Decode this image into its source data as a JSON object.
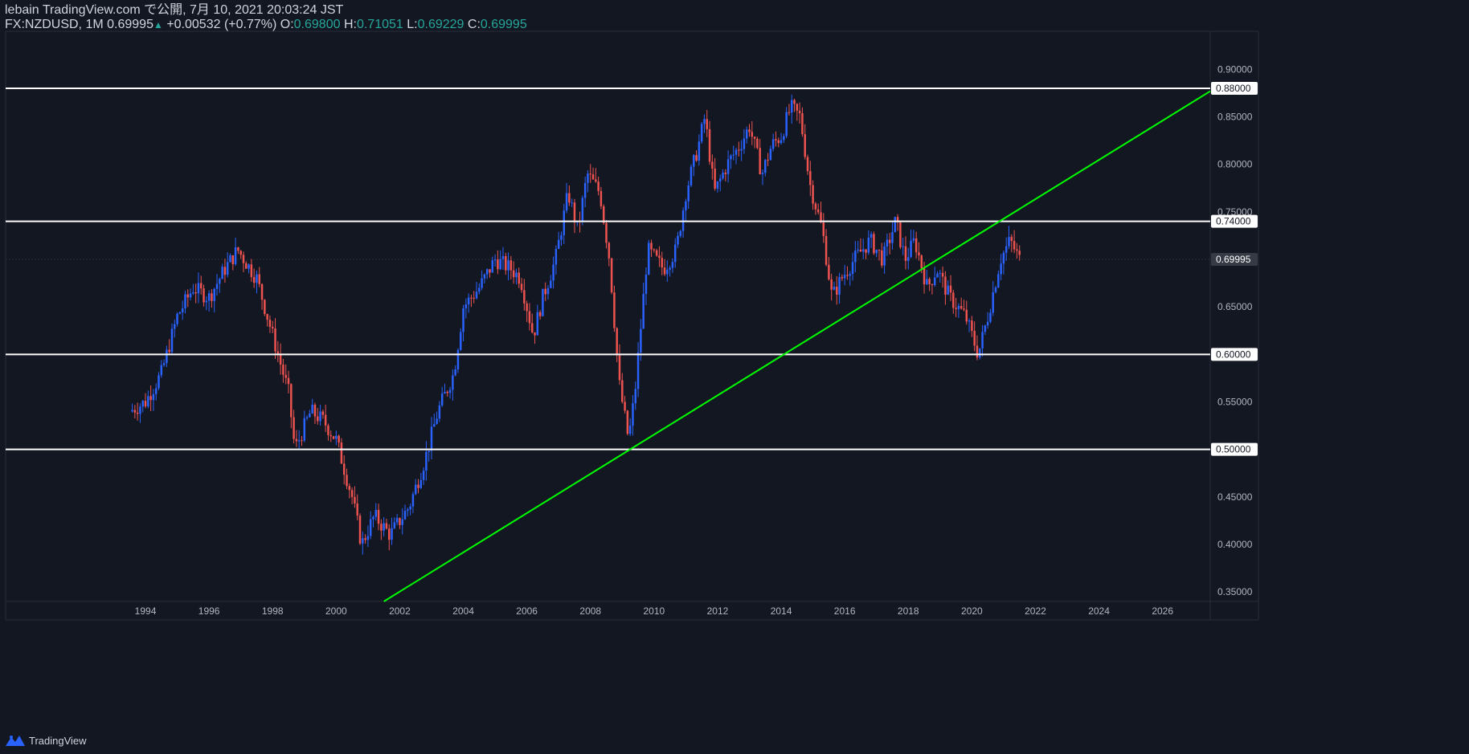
{
  "header": {
    "line1": "lebain TradingView.com で公開, 7月 10, 2021 20:03:24 JST",
    "symbol": "FX:NZDUSD, 1M",
    "last": "0.69995",
    "change_arrow": "▲",
    "change": "+0.00532 (+0.77%)",
    "o_label": "O:",
    "o_value": "0.69800",
    "h_label": "H:",
    "h_value": "0.71051",
    "l_label": "L:",
    "l_value": "0.69229",
    "c_label": "C:",
    "c_value": "0.69995"
  },
  "footer": {
    "brand": "TradingView"
  },
  "colors": {
    "background": "#131722",
    "up": "#2962ff",
    "down": "#ef5350",
    "level_line": "#ffffff",
    "trend_line": "#00ff00",
    "text": "#d1d4dc",
    "accent": "#26a69a"
  },
  "chart_data": {
    "type": "candlestick",
    "symbol": "NZDUSD",
    "interval": "1M",
    "xlim": [
      1989.6,
      2027.5
    ],
    "ylim": [
      0.34,
      0.94
    ],
    "x_ticks": [
      "1994",
      "1996",
      "1998",
      "2000",
      "2002",
      "2004",
      "2006",
      "2008",
      "2010",
      "2012",
      "2014",
      "2016",
      "2018",
      "2020",
      "2022",
      "2024",
      "2026"
    ],
    "y_ticks": [
      "0.35000",
      "0.40000",
      "0.45000",
      "0.50000",
      "0.55000",
      "0.60000",
      "0.65000",
      "0.70000",
      "0.75000",
      "0.80000",
      "0.85000",
      "0.90000"
    ],
    "horizontal_levels": [
      {
        "value": 0.88,
        "label": "0.88000"
      },
      {
        "value": 0.74,
        "label": "0.74000"
      },
      {
        "value": 0.6,
        "label": "0.60000"
      },
      {
        "value": 0.5,
        "label": "0.50000"
      }
    ],
    "current_price": {
      "value": 0.69995,
      "label": "0.69995"
    },
    "trendline": {
      "start": [
        2001.5,
        0.34
      ],
      "end": [
        2027.5,
        0.877
      ]
    },
    "close_path": [
      [
        1993.5,
        0.54
      ],
      [
        1994.0,
        0.55
      ],
      [
        1994.5,
        0.58
      ],
      [
        1995.0,
        0.64
      ],
      [
        1995.5,
        0.67
      ],
      [
        1996.0,
        0.66
      ],
      [
        1996.5,
        0.69
      ],
      [
        1996.9,
        0.71
      ],
      [
        1997.5,
        0.68
      ],
      [
        1998.0,
        0.62
      ],
      [
        1998.5,
        0.56
      ],
      [
        1998.7,
        0.5
      ],
      [
        1999.2,
        0.54
      ],
      [
        1999.6,
        0.53
      ],
      [
        2000.0,
        0.51
      ],
      [
        2000.5,
        0.45
      ],
      [
        2000.8,
        0.4
      ],
      [
        2001.2,
        0.43
      ],
      [
        2001.7,
        0.41
      ],
      [
        2002.3,
        0.44
      ],
      [
        2002.8,
        0.49
      ],
      [
        2003.2,
        0.54
      ],
      [
        2003.7,
        0.58
      ],
      [
        2004.0,
        0.65
      ],
      [
        2004.5,
        0.67
      ],
      [
        2005.0,
        0.7
      ],
      [
        2005.5,
        0.69
      ],
      [
        2005.8,
        0.68
      ],
      [
        2006.2,
        0.62
      ],
      [
        2006.5,
        0.66
      ],
      [
        2006.9,
        0.7
      ],
      [
        2007.3,
        0.77
      ],
      [
        2007.6,
        0.73
      ],
      [
        2007.9,
        0.79
      ],
      [
        2008.3,
        0.77
      ],
      [
        2008.6,
        0.7
      ],
      [
        2008.9,
        0.57
      ],
      [
        2009.2,
        0.51
      ],
      [
        2009.4,
        0.56
      ],
      [
        2009.8,
        0.71
      ],
      [
        2010.3,
        0.69
      ],
      [
        2010.7,
        0.71
      ],
      [
        2011.0,
        0.77
      ],
      [
        2011.4,
        0.82
      ],
      [
        2011.6,
        0.85
      ],
      [
        2011.9,
        0.77
      ],
      [
        2012.3,
        0.8
      ],
      [
        2012.7,
        0.82
      ],
      [
        2013.0,
        0.84
      ],
      [
        2013.4,
        0.79
      ],
      [
        2013.7,
        0.82
      ],
      [
        2014.0,
        0.83
      ],
      [
        2014.3,
        0.86
      ],
      [
        2014.6,
        0.85
      ],
      [
        2014.9,
        0.78
      ],
      [
        2015.3,
        0.73
      ],
      [
        2015.6,
        0.66
      ],
      [
        2015.9,
        0.68
      ],
      [
        2016.3,
        0.7
      ],
      [
        2016.8,
        0.72
      ],
      [
        2017.2,
        0.7
      ],
      [
        2017.6,
        0.74
      ],
      [
        2017.9,
        0.7
      ],
      [
        2018.2,
        0.72
      ],
      [
        2018.6,
        0.67
      ],
      [
        2018.9,
        0.69
      ],
      [
        2019.3,
        0.66
      ],
      [
        2019.8,
        0.64
      ],
      [
        2020.2,
        0.6
      ],
      [
        2020.5,
        0.64
      ],
      [
        2020.9,
        0.7
      ],
      [
        2021.2,
        0.72
      ],
      [
        2021.5,
        0.69995
      ]
    ]
  }
}
